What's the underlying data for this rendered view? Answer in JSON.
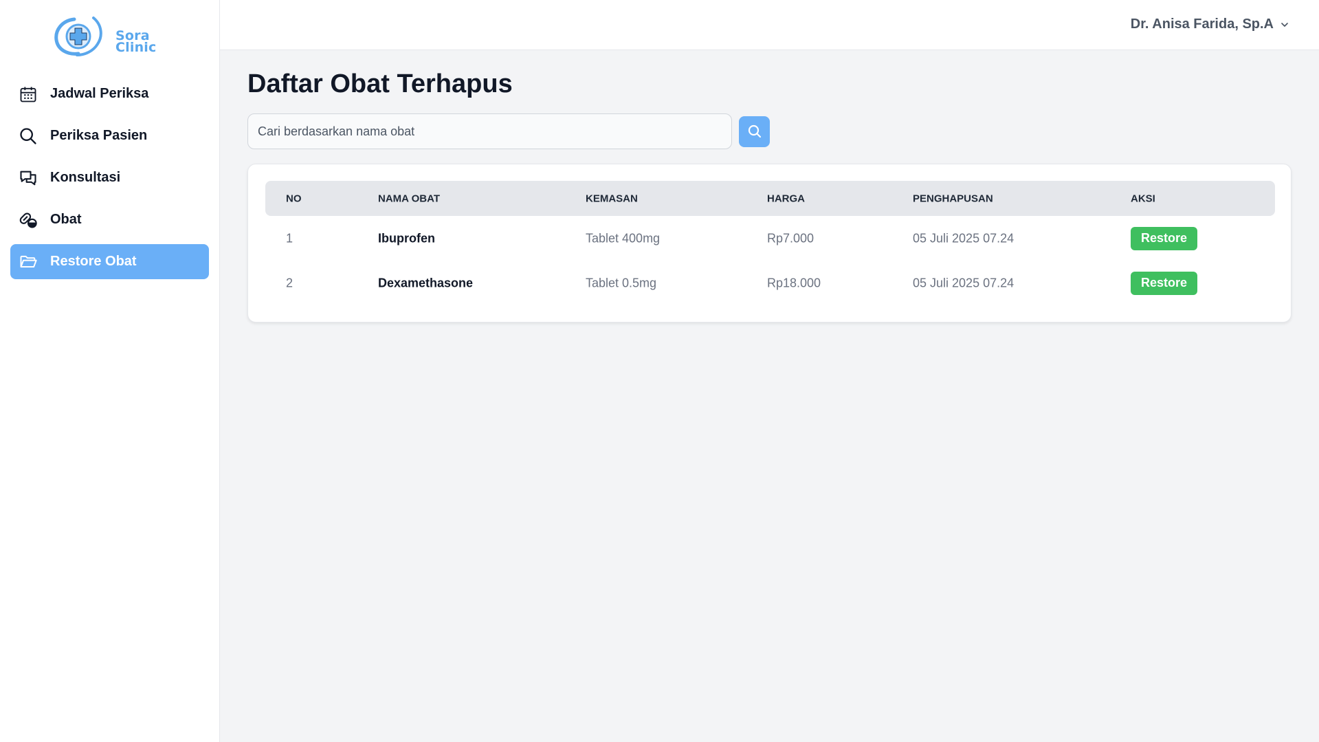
{
  "brand": {
    "line1": "Sora",
    "line2": "Clinic",
    "color": "#5aa7ec"
  },
  "sidebar": {
    "items": [
      {
        "label": "Jadwal Periksa",
        "icon": "calendar-icon",
        "active": false
      },
      {
        "label": "Periksa Pasien",
        "icon": "search-icon",
        "active": false
      },
      {
        "label": "Konsultasi",
        "icon": "chat-bubbles-icon",
        "active": false
      },
      {
        "label": "Obat",
        "icon": "pills-icon",
        "active": false
      },
      {
        "label": "Restore Obat",
        "icon": "folder-open-icon",
        "active": true
      }
    ]
  },
  "header": {
    "user_name": "Dr. Anisa Farida, Sp.A",
    "dropdown_icon": "chevron-down-icon"
  },
  "page": {
    "title": "Daftar Obat Terhapus"
  },
  "search": {
    "placeholder": "Cari berdasarkan nama obat",
    "value": "",
    "button_icon": "search-icon"
  },
  "table": {
    "columns": [
      "NO",
      "NAMA OBAT",
      "KEMASAN",
      "HARGA",
      "PENGHAPUSAN",
      "AKSI"
    ],
    "rows": [
      {
        "no": "1",
        "nama": "Ibuprofen",
        "kemasan": "Tablet 400mg",
        "harga": "Rp7.000",
        "penghapusan": "05 Juli 2025 07.24",
        "aksi": "Restore"
      },
      {
        "no": "2",
        "nama": "Dexamethasone",
        "kemasan": "Tablet 0.5mg",
        "harga": "Rp18.000",
        "penghapusan": "05 Juli 2025 07.24",
        "aksi": "Restore"
      }
    ]
  },
  "colors": {
    "accent": "#6aaff7",
    "restore": "#3fbf5f",
    "background": "#f3f4f6"
  }
}
